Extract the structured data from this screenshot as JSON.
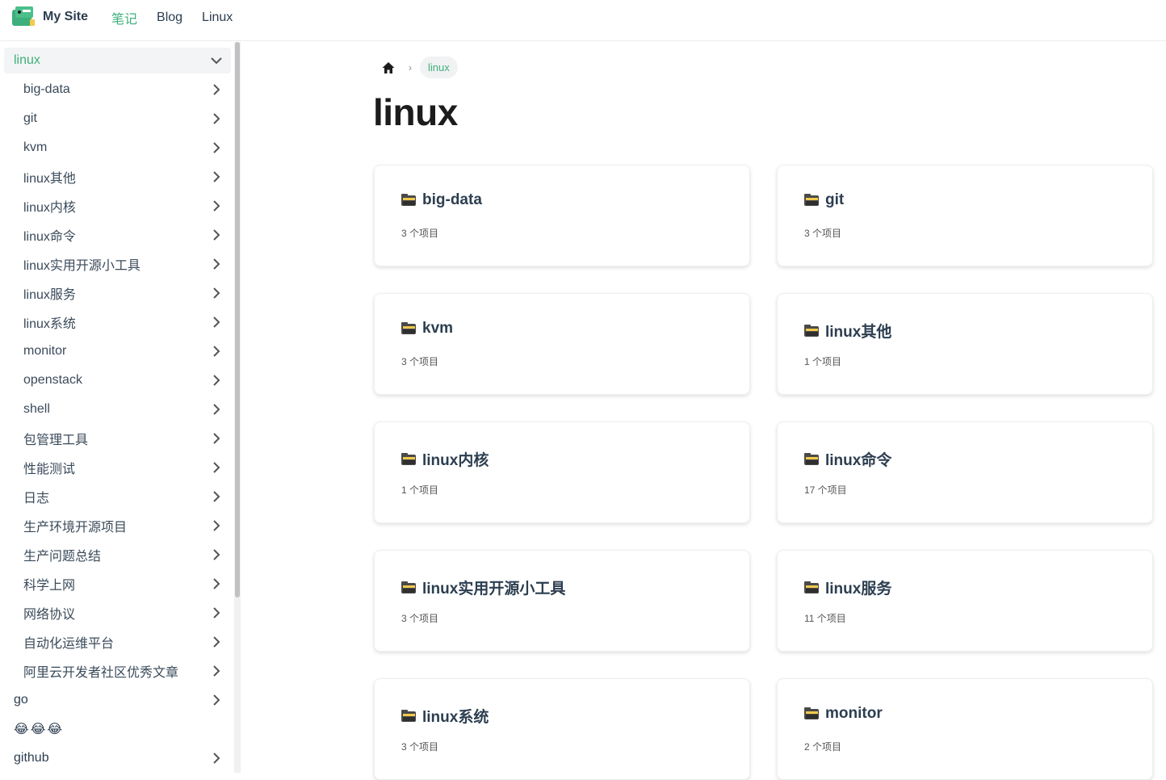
{
  "navbar": {
    "site_name": "My Site",
    "links": [
      "笔记",
      "Blog",
      "Linux"
    ],
    "active_link": "笔记"
  },
  "sidebar": {
    "active_group": "linux",
    "sub_items": [
      "big-data",
      "git",
      "kvm",
      "linux其他",
      "linux内核",
      "linux命令",
      "linux实用开源小工具",
      "linux服务",
      "linux系统",
      "monitor",
      "openstack",
      "shell",
      "包管理工具",
      "性能测试",
      "日志",
      "生产环境开源项目",
      "生产问题总结",
      "科学上网",
      "网络协议",
      "自动化运维平台",
      "阿里云开发者社区优秀文章"
    ],
    "after_items": [
      "go",
      "😂😂😂",
      "github"
    ]
  },
  "breadcrumb": {
    "current": "linux"
  },
  "page_title": "linux",
  "cards": [
    {
      "title": "big-data",
      "count": "3 个项目"
    },
    {
      "title": "git",
      "count": "3 个项目"
    },
    {
      "title": "kvm",
      "count": "3 个项目"
    },
    {
      "title": "linux其他",
      "count": "1 个项目"
    },
    {
      "title": "linux内核",
      "count": "1 个项目"
    },
    {
      "title": "linux命令",
      "count": "17 个项目"
    },
    {
      "title": "linux实用开源小工具",
      "count": "3 个项目"
    },
    {
      "title": "linux服务",
      "count": "11 个项目"
    },
    {
      "title": "linux系统",
      "count": "3 个项目"
    },
    {
      "title": "monitor",
      "count": "2 个项目"
    }
  ],
  "colors": {
    "accent": "#3eaf7c",
    "text": "#2c3e50"
  },
  "icons": {
    "home": "home-icon",
    "folder": "folder-icon",
    "chevron": "chevron-right-icon"
  }
}
